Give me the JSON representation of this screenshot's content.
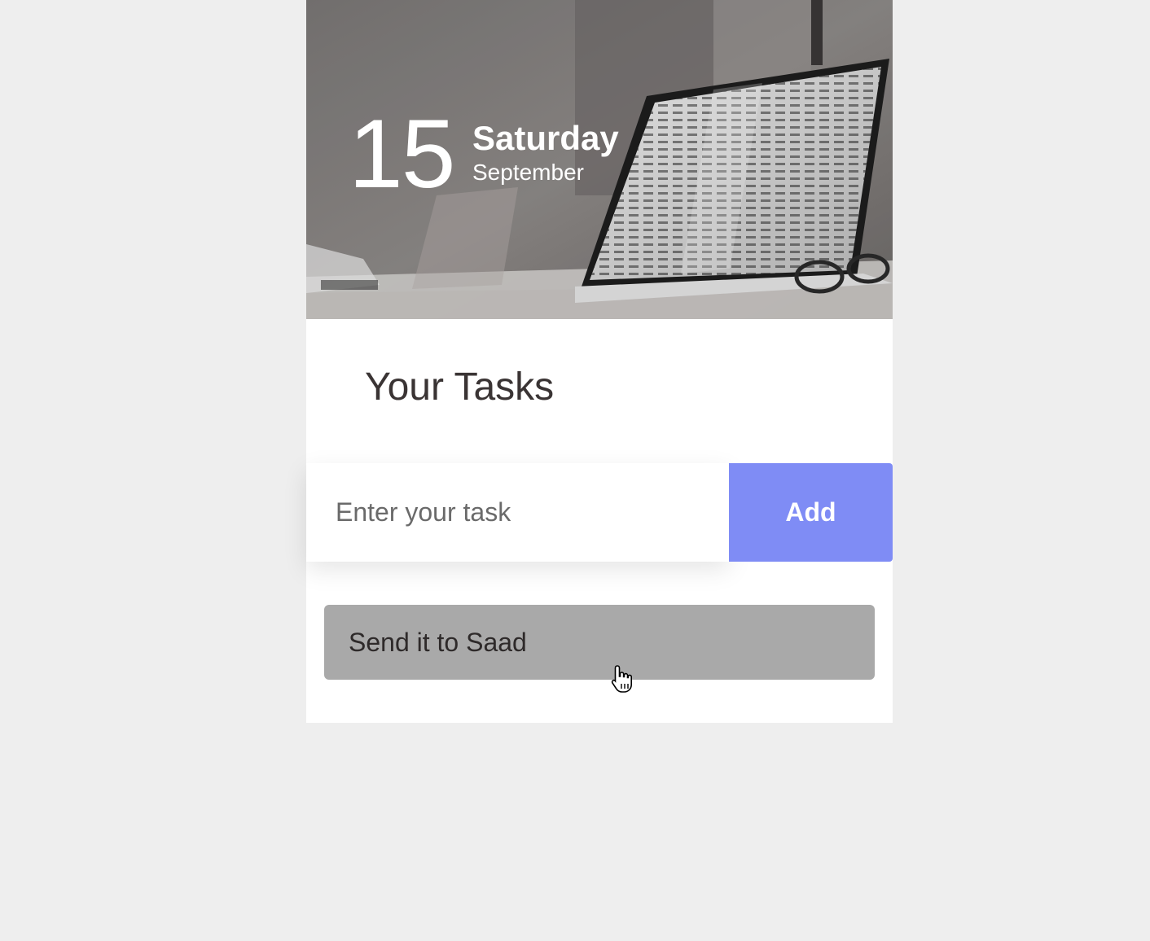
{
  "header": {
    "day_number": "15",
    "weekday": "Saturday",
    "month": "September"
  },
  "main": {
    "title": "Your Tasks",
    "input_placeholder": "Enter your task",
    "add_label": "Add",
    "tasks": [
      {
        "label": "Send it to Saad"
      }
    ]
  },
  "colors": {
    "accent": "#7f8cf5",
    "task_background": "#a9a9a9",
    "page_background": "#eeeeee"
  },
  "icons": {
    "cursor": "hand-pointer-icon"
  }
}
